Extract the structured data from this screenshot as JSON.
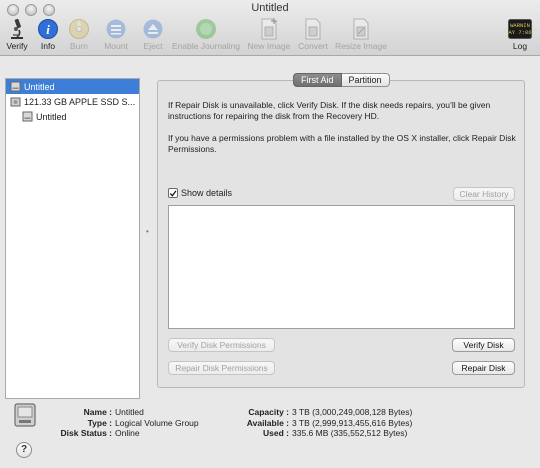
{
  "window": {
    "title": "Untitled"
  },
  "toolbar": {
    "items": [
      {
        "label": "Verify",
        "icon": "microscope-icon",
        "enabled": true
      },
      {
        "label": "Info",
        "icon": "info-icon",
        "enabled": true
      },
      {
        "label": "Burn",
        "icon": "burn-disc-icon",
        "enabled": false
      },
      {
        "label": "Mount",
        "icon": "mount-icon",
        "enabled": false
      },
      {
        "label": "Eject",
        "icon": "eject-icon",
        "enabled": false
      },
      {
        "label": "Enable Journaling",
        "icon": "journaling-icon",
        "enabled": false
      },
      {
        "label": "New Image",
        "icon": "new-image-icon",
        "enabled": false
      },
      {
        "label": "Convert",
        "icon": "convert-icon",
        "enabled": false
      },
      {
        "label": "Resize Image",
        "icon": "resize-image-icon",
        "enabled": false
      }
    ],
    "log": {
      "label": "Log",
      "icon_text_top": "WARNIN",
      "icon_text_bottom": "AY 7:06"
    }
  },
  "sidebar": {
    "items": [
      {
        "label": "Untitled",
        "selected": true,
        "indent": 0
      },
      {
        "label": "121.33 GB APPLE SSD S...",
        "selected": false,
        "indent": 0
      },
      {
        "label": "Untitled",
        "selected": false,
        "indent": 1
      }
    ]
  },
  "tabs": [
    {
      "label": "First Aid",
      "active": true
    },
    {
      "label": "Partition",
      "active": false
    }
  ],
  "first_aid": {
    "paragraph1": "If Repair Disk is unavailable, click Verify Disk. If the disk needs repairs, you’ll be given instructions for repairing the disk from the Recovery HD.",
    "paragraph2": "If you have a permissions problem with a file installed by the OS X installer, click Repair Disk Permissions.",
    "show_details_label": "Show details",
    "show_details_checked": true,
    "clear_history_label": "Clear History",
    "verify_permissions_label": "Verify Disk Permissions",
    "repair_permissions_label": "Repair Disk Permissions",
    "verify_disk_label": "Verify Disk",
    "repair_disk_label": "Repair Disk"
  },
  "info": {
    "name_key": "Name :",
    "name_val": "Untitled",
    "type_key": "Type :",
    "type_val": "Logical Volume Group",
    "status_key": "Disk Status :",
    "status_val": "Online",
    "capacity_key": "Capacity :",
    "capacity_val": "3 TB (3,000,249,008,128 Bytes)",
    "available_key": "Available :",
    "available_val": "3 TB (2,999,913,455,616 Bytes)",
    "used_key": "Used :",
    "used_val": "335.6 MB (335,552,512 Bytes)"
  },
  "help_label": "?",
  "colors": {
    "selection": "#3d7fd8",
    "info_blue": "#2f6fd6",
    "log_green": "#c8a83a"
  }
}
